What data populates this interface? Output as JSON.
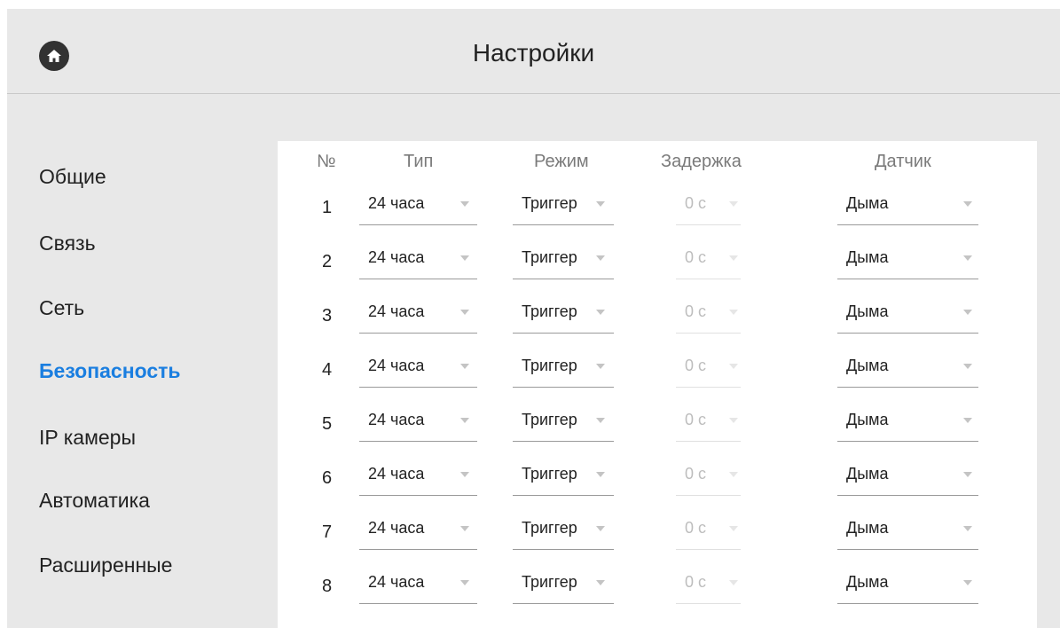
{
  "header": {
    "title": "Настройки",
    "home_icon": "home-icon"
  },
  "sidebar": {
    "active_color": "#1a7ee0",
    "items": [
      {
        "label": "Общие",
        "active": false
      },
      {
        "label": "Связь",
        "active": false
      },
      {
        "label": "Сеть",
        "active": false
      },
      {
        "label": "Безопасность",
        "active": true
      },
      {
        "label": "IP камеры",
        "active": false
      },
      {
        "label": "Автоматика",
        "active": false
      },
      {
        "label": "Расширенные",
        "active": false
      }
    ]
  },
  "table": {
    "columns": [
      "№",
      "Тип",
      "Режим",
      "Задержка",
      "Датчик"
    ],
    "rows": [
      {
        "num": "1",
        "type": "24 часа",
        "mode": "Триггер",
        "delay": "0 с",
        "sensor": "Дыма"
      },
      {
        "num": "2",
        "type": "24 часа",
        "mode": "Триггер",
        "delay": "0 с",
        "sensor": "Дыма"
      },
      {
        "num": "3",
        "type": "24 часа",
        "mode": "Триггер",
        "delay": "0 с",
        "sensor": "Дыма"
      },
      {
        "num": "4",
        "type": "24 часа",
        "mode": "Триггер",
        "delay": "0 с",
        "sensor": "Дыма"
      },
      {
        "num": "5",
        "type": "24 часа",
        "mode": "Триггер",
        "delay": "0 с",
        "sensor": "Дыма"
      },
      {
        "num": "6",
        "type": "24 часа",
        "mode": "Триггер",
        "delay": "0 с",
        "sensor": "Дыма"
      },
      {
        "num": "7",
        "type": "24 часа",
        "mode": "Триггер",
        "delay": "0 с",
        "sensor": "Дыма"
      },
      {
        "num": "8",
        "type": "24 часа",
        "mode": "Триггер",
        "delay": "0 с",
        "sensor": "Дыма"
      }
    ]
  }
}
